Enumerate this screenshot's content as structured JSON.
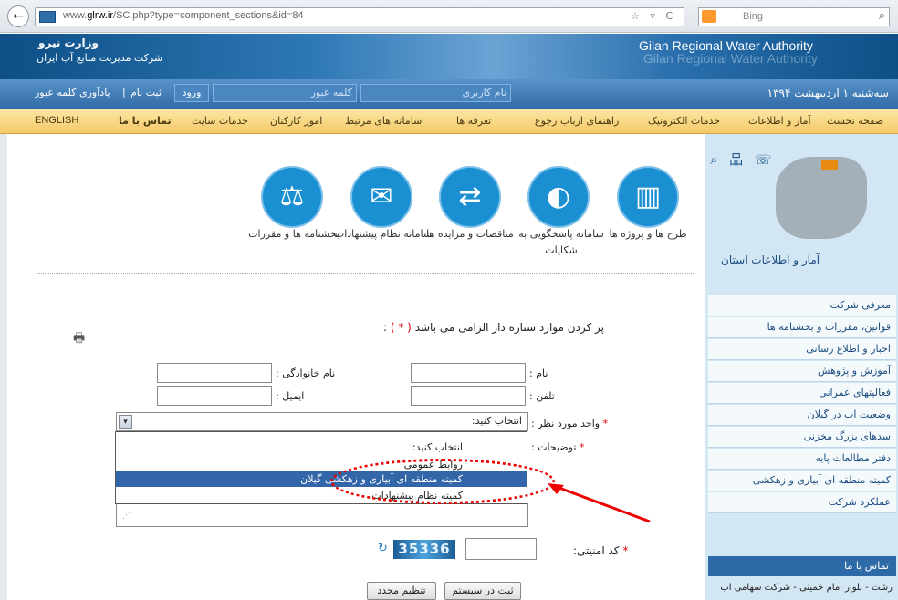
{
  "browser": {
    "url_prefix": "www.",
    "url_domain": "glrw.ir",
    "url_path": "/SC.php?type=component_sections&id=84",
    "search_engine": "Bing",
    "nav_icons": "☆ ▿ C"
  },
  "header": {
    "ministry": "وزارت نیرو",
    "company": "شرکت مدیریت منابع آب ایران",
    "authority_en": "Gilan Regional Water Authority"
  },
  "login": {
    "date": "سه‌شنبه ۱ اردیبهشت ۱۳۹۴",
    "username_placeholder": "نام کاربری",
    "password_placeholder": "کلمه عبور",
    "login_label": "ورود",
    "register_label": "ثبت نام",
    "separator": "|",
    "remind_label": "یادآوری کلمه عبور"
  },
  "menu": {
    "items": [
      "صفحه نخست",
      "آمار و اطلاعات",
      "خدمات الکترونیک",
      "راهنمای ارباب رجوع",
      "تعرفه ها",
      "سامانه های مرتبط",
      "امور کارکنان",
      "خدمات سایت",
      "تماس با ما",
      "ENGLISH"
    ]
  },
  "services": {
    "items": [
      {
        "label": "طرح ها و پروژه ها",
        "icon": "building-icon"
      },
      {
        "label": "سامانه پاسخگویی به شکایات",
        "icon": "headset-icon"
      },
      {
        "label": "مناقصات و مزایده ها",
        "icon": "handshake-icon"
      },
      {
        "label": "سامانه نظام پیشنهادات",
        "icon": "envelope-icon"
      },
      {
        "label": "بخشنامه ها و مقررات",
        "icon": "scales-icon"
      }
    ]
  },
  "sidebar": {
    "map_title": "آمار و اطلاعات استان",
    "icons": "⌕ 品 ☏",
    "items": [
      "معرفی شرکت",
      "قوانین، مقررات و بخشنامه ها",
      "اخبار و اطلاع رسانی",
      "آموزش و پژوهش",
      "فعالیتهای عمرانی",
      "وضعیت آب در گیلان",
      "سدهای بزرگ مخزنی",
      "دفتر مطالعات پایه",
      "کمیته منطقه ای آبیاری و زهکشی",
      "عملکرد شرکت"
    ],
    "contact_header": "تماس با ما",
    "contact_address": "رشت - بلوار امام خمینی - شرکت سهامی آب"
  },
  "form": {
    "print_icon": "🖶",
    "required_note": "پر کردن موارد ستاره دار الزامی می باشد",
    "required_star": "( * )",
    "required_colon": ":",
    "first_name_label": "نام :",
    "last_name_label": "نام خانوادگی :",
    "phone_label": "تلفن :",
    "email_label": "ایمیل :",
    "unit_label": "واحد مورد نظر :",
    "star": "*",
    "select_value": "انتخاب کنید:",
    "select_arrow": "▾",
    "dropdown_options": [
      "انتخاب کنید:",
      "روابط عمومی",
      "کمیته منطقه ای آبیاری و زهکشی گیلان",
      "کمیته نظام پیشنهادات"
    ],
    "description_label": "توضیحات :",
    "resize_grip": "⋰",
    "captcha_label": "کد امنیتی:",
    "captcha_value": "35336",
    "refresh_icon": "↻",
    "submit_label": "ثبت در سیستم",
    "reset_label": "تنظیم مجدد"
  }
}
